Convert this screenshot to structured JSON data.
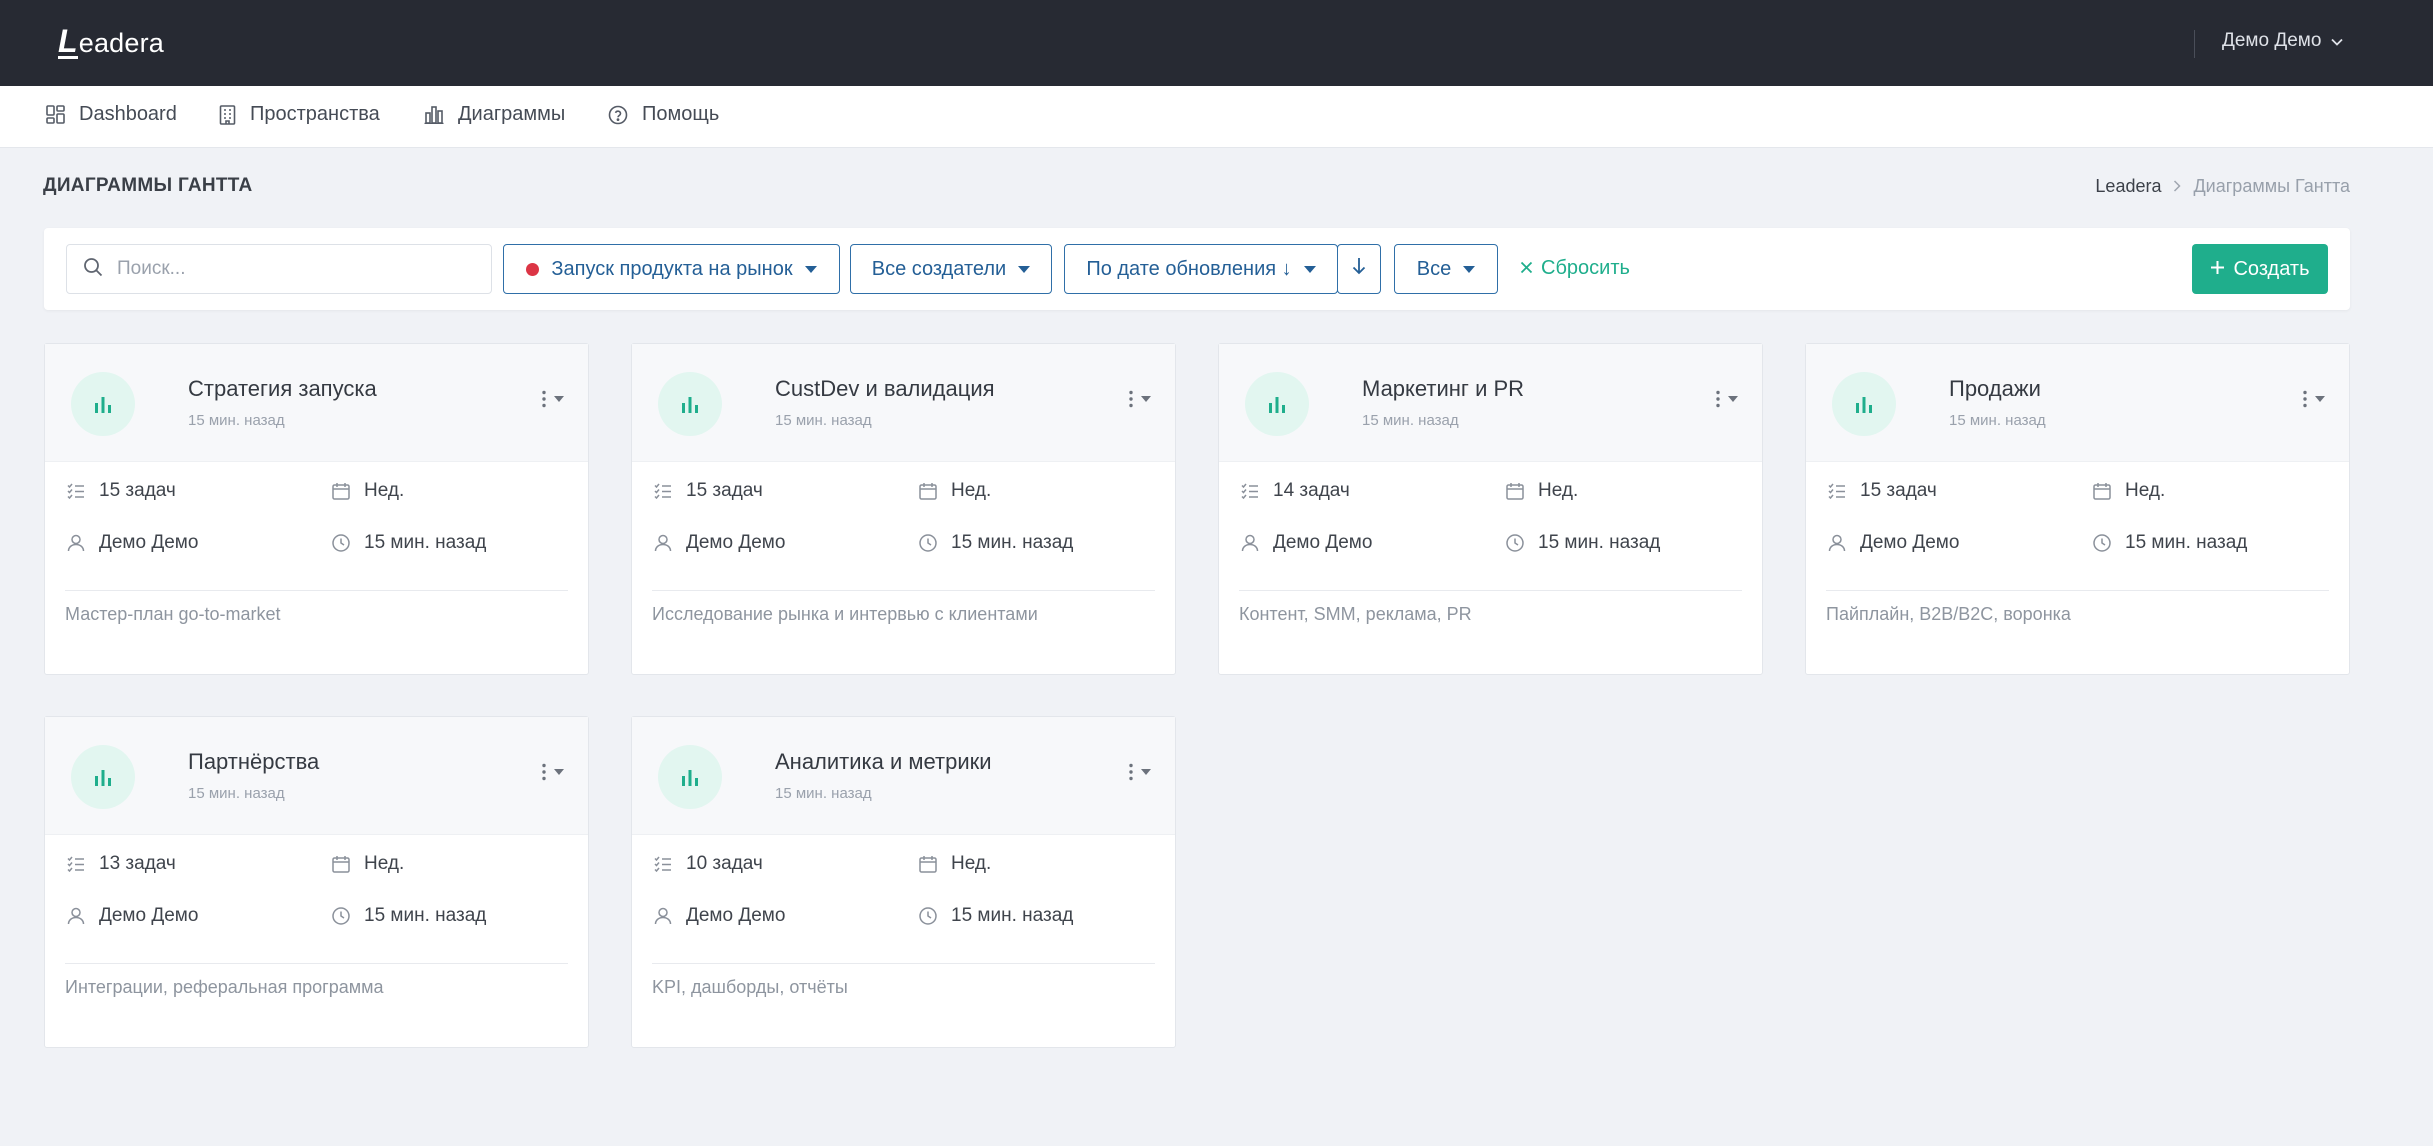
{
  "app": {
    "logo_first": "L",
    "logo_rest": "eadera",
    "user_name": "Демо Демо"
  },
  "nav": [
    {
      "label": "Dashboard",
      "icon": "dashboard-icon"
    },
    {
      "label": "Пространства",
      "icon": "building-icon"
    },
    {
      "label": "Диаграммы",
      "icon": "chart-icon"
    },
    {
      "label": "Помощь",
      "icon": "help-icon"
    }
  ],
  "page": {
    "title": "ДИАГРАММЫ ГАНТТА"
  },
  "breadcrumb": {
    "root": "Leadera",
    "current": "Диаграммы Гантта"
  },
  "toolbar": {
    "search_placeholder": "Поиск...",
    "space_filter": "Запуск продукта на рынок",
    "creators_filter": "Все создатели",
    "sort_filter": "По дате обновления ↓",
    "status_filter": "Все",
    "reset_label": "Сбросить",
    "create_label": "Создать"
  },
  "colors": {
    "accent": "#1fae8c",
    "primary": "#245f96",
    "danger": "#dc3545",
    "topbar": "#272a33"
  },
  "cards": [
    {
      "title": "Стратегия запуска",
      "time": "15 мин. назад",
      "tasks": "15 задач",
      "period": "Нед.",
      "owner": "Демо Демо",
      "updated": "15 мин. назад",
      "description": "Мастер-план go-to-market"
    },
    {
      "title": "CustDev и валидация",
      "time": "15 мин. назад",
      "tasks": "15 задач",
      "period": "Нед.",
      "owner": "Демо Демо",
      "updated": "15 мин. назад",
      "description": "Исследование рынка и интервью с клиентами"
    },
    {
      "title": "Маркетинг и PR",
      "time": "15 мин. назад",
      "tasks": "14 задач",
      "period": "Нед.",
      "owner": "Демо Демо",
      "updated": "15 мин. назад",
      "description": "Контент, SMM, реклама, PR"
    },
    {
      "title": "Продажи",
      "time": "15 мин. назад",
      "tasks": "15 задач",
      "period": "Нед.",
      "owner": "Демо Демо",
      "updated": "15 мин. назад",
      "description": "Пайплайн, B2B/B2C, воронка"
    },
    {
      "title": "Партнёрства",
      "time": "15 мин. назад",
      "tasks": "13 задач",
      "period": "Нед.",
      "owner": "Демо Демо",
      "updated": "15 мин. назад",
      "description": "Интеграции, реферальная программа"
    },
    {
      "title": "Аналитика и метрики",
      "time": "15 мин. назад",
      "tasks": "10 задач",
      "period": "Нед.",
      "owner": "Демо Демо",
      "updated": "15 мин. назад",
      "description": "KPI, дашборды, отчёты"
    }
  ]
}
